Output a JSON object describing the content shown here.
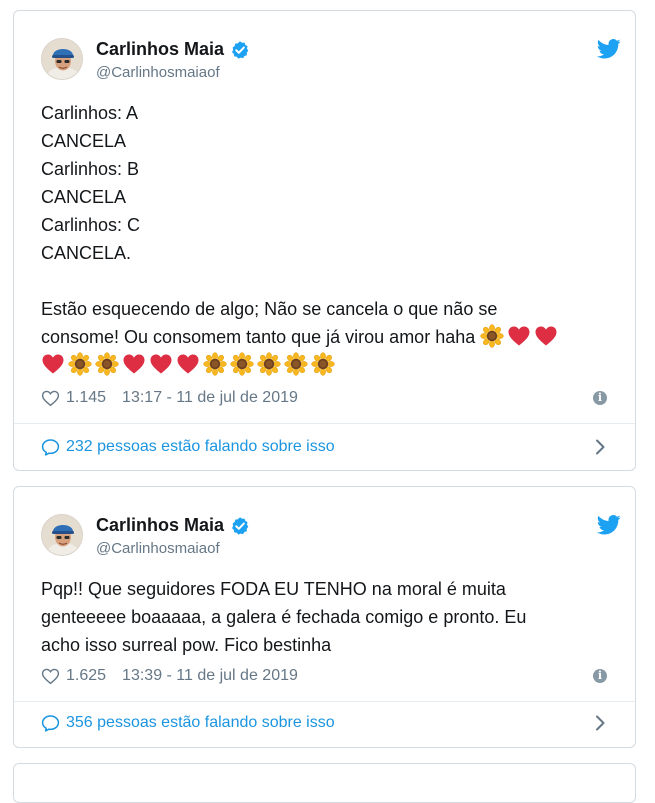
{
  "tweets": [
    {
      "author": {
        "name": "Carlinhos Maia",
        "handle": "@Carlinhosmaiaof"
      },
      "lines": [
        "Carlinhos: A",
        "CANCELA",
        "Carlinhos: B",
        "CANCELA",
        "Carlinhos: C",
        "CANCELA."
      ],
      "paragraph": [
        "Estão esquecendo de algo; Não se cancela o que não se",
        "consome! Ou consomem tanto que já virou amor haha"
      ],
      "likes": "1.145",
      "timestamp": "13:17 - 11 de jul de 2019",
      "conversation": "232 pessoas estão falando sobre isso"
    },
    {
      "author": {
        "name": "Carlinhos Maia",
        "handle": "@Carlinhosmaiaof"
      },
      "lines": [
        "Pqp!! Que seguidores FODA EU TENHO na moral é muita",
        "genteeeee boaaaaa, a galera é fechada comigo e pronto. Eu",
        "acho isso surreal pow. Fico bestinha"
      ],
      "likes": "1.625",
      "timestamp": "13:39 - 11 de jul de 2019",
      "conversation": "356 pessoas estão falando sobre isso"
    }
  ],
  "colors": {
    "link": "#1b95e0",
    "meta": "#657786",
    "border": "#d4dbe1",
    "verified": "#1da1f2"
  },
  "icons": [
    "verified-badge-icon",
    "twitter-bird-icon",
    "heart-icon",
    "info-icon",
    "chat-bubble-icon",
    "chevron-right-icon",
    "sunflower-emoji",
    "red-heart-emoji"
  ]
}
